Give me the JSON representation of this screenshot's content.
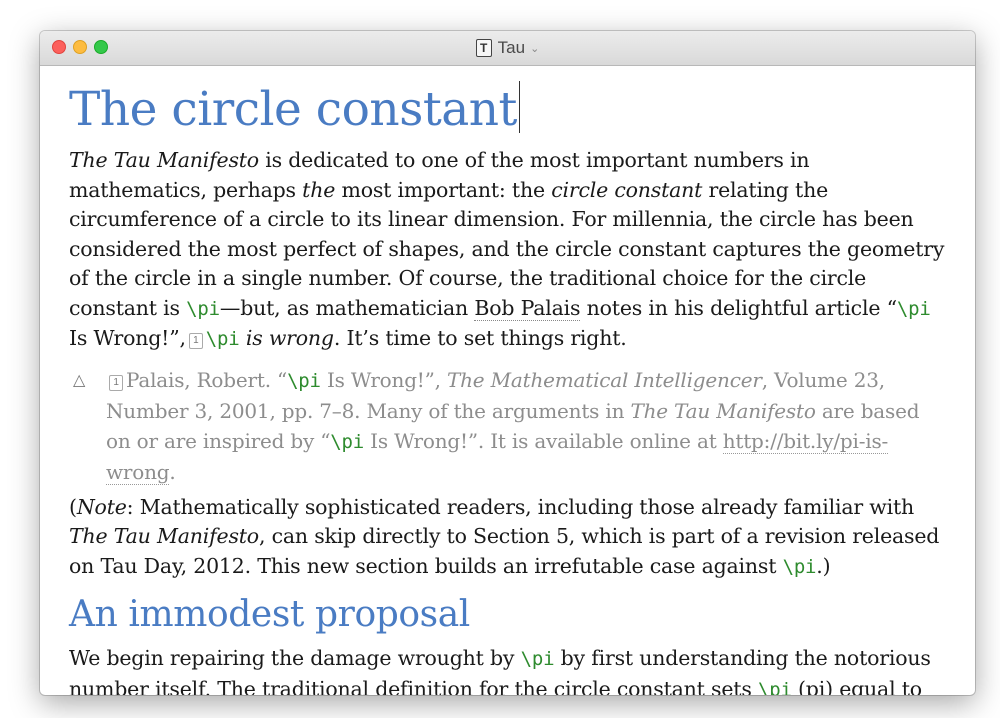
{
  "window": {
    "title": "Tau",
    "doc_icon_letter": "T",
    "chevron": "⌄"
  },
  "document": {
    "title": "The circle constant",
    "para1": [
      {
        "t": "The Tau Manifesto",
        "s": "em"
      },
      {
        "t": " is dedicated to one of the most important numbers in mathematics, perhaps "
      },
      {
        "t": "the",
        "s": "em"
      },
      {
        "t": " most important: the "
      },
      {
        "t": "circle constant",
        "s": "em"
      },
      {
        "t": " relating the circumference of a circle to its linear dimension. For millennia, the circle has been considered the most perfect of shapes, and the circle constant captures the geometry of the circle in a single number. Of course, the traditional choice for the circle constant is "
      },
      {
        "t": "\\pi",
        "s": "code"
      },
      {
        "t": "—but, as mathematician "
      },
      {
        "t": "Bob Palais",
        "s": "link"
      },
      {
        "t": " notes in his delightful article “"
      },
      {
        "t": "\\pi",
        "s": "code"
      },
      {
        "t": " Is Wrong!”,"
      },
      {
        "t": "1",
        "s": "fnref"
      },
      {
        "t": "\\pi",
        "s": "code"
      },
      {
        "t": " "
      },
      {
        "t": "is wrong",
        "s": "em"
      },
      {
        "t": ". It’s time to set things right."
      }
    ],
    "footnote": [
      {
        "t": "1",
        "s": "fnref"
      },
      {
        "t": "Palais, Robert. “"
      },
      {
        "t": "\\pi",
        "s": "code"
      },
      {
        "t": " Is Wrong!”, "
      },
      {
        "t": "The Mathematical Intelligencer",
        "s": "em"
      },
      {
        "t": ", Volume 23, Number 3, 2001, pp. 7–8. Many of the arguments in "
      },
      {
        "t": "The Tau Manifesto",
        "s": "em"
      },
      {
        "t": " are based on or are inspired by “"
      },
      {
        "t": "\\pi",
        "s": "code"
      },
      {
        "t": " Is Wrong!”. It is available online at "
      },
      {
        "t": "http://bit.ly/pi-is-wrong",
        "s": "link"
      },
      {
        "t": "."
      }
    ],
    "footnote_arrow": "△",
    "para2": [
      {
        "t": "("
      },
      {
        "t": "Note",
        "s": "em"
      },
      {
        "t": ": Mathematically sophisticated readers, including those already familiar with "
      },
      {
        "t": "The Tau Manifesto",
        "s": "em"
      },
      {
        "t": ", can skip directly to Section 5, which is part of a revision released on Tau Day, 2012. This new section builds an irrefutable case against "
      },
      {
        "t": "\\pi",
        "s": "code"
      },
      {
        "t": ".)"
      }
    ],
    "section_title": "An immodest proposal",
    "para3": [
      {
        "t": "We begin repairing the damage wrought by "
      },
      {
        "t": "\\pi",
        "s": "code"
      },
      {
        "t": " by first understanding the notorious number itself. The traditional definition for the circle constant sets "
      },
      {
        "t": "\\pi",
        "s": "code"
      },
      {
        "t": " (pi) equal to"
      }
    ]
  }
}
